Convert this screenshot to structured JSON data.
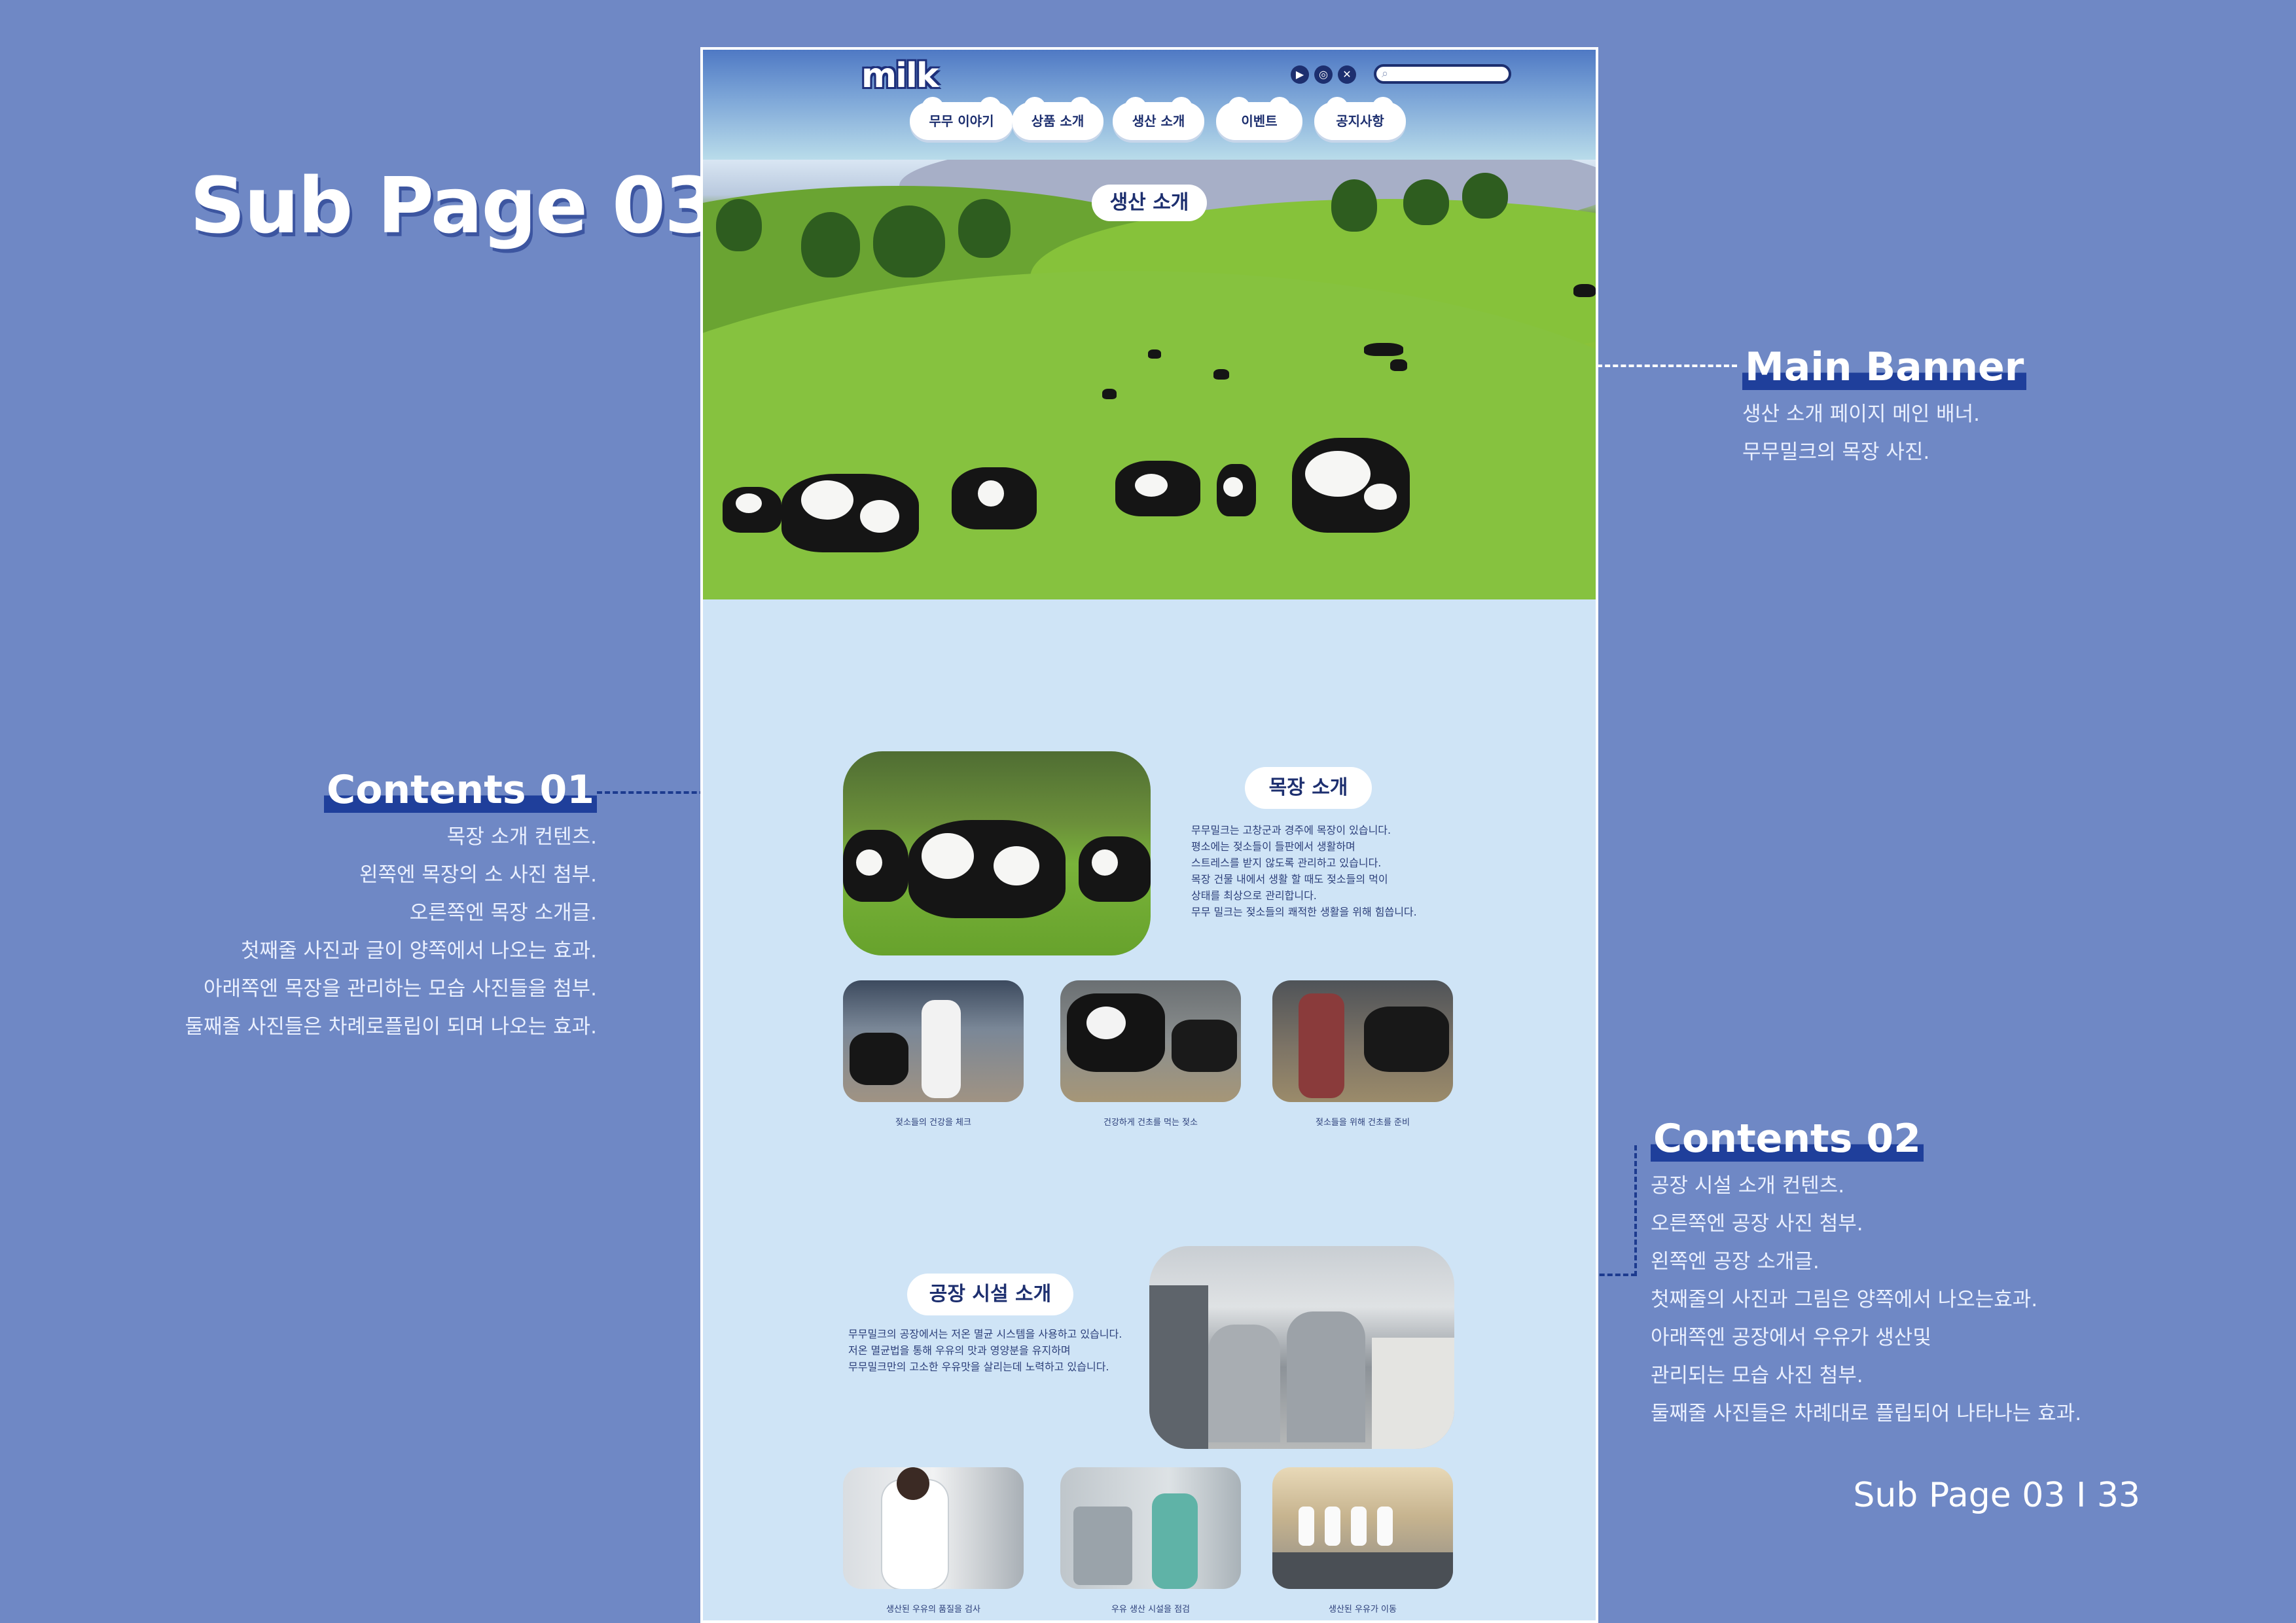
{
  "page": {
    "title": "Sub Page 03",
    "footer": "Sub Page 03 I 33"
  },
  "annotations": {
    "main_banner": {
      "title": "Main Banner",
      "lines": [
        "생산 소개 페이지 메인 배너.",
        "무무밀크의 목장 사진."
      ]
    },
    "contents01": {
      "title": "Contents 01",
      "lines": [
        "목장 소개 컨텐츠.",
        "왼쪽엔 목장의 소 사진 첨부.",
        "오른쪽엔 목장 소개글.",
        "첫째줄 사진과 글이 양쪽에서 나오는 효과.",
        "아래쪽엔 목장을 관리하는 모습 사진들을 첨부.",
        "둘째줄 사진들은 차례로플립이 되며 나오는 효과."
      ]
    },
    "contents02": {
      "title": "Contents 02",
      "lines": [
        "공장 시설 소개 컨텐츠.",
        "오른쪽엔 공장 사진 첨부.",
        "왼쪽엔 공장 소개글.",
        "첫째줄의 사진과 그림은 양쪽에서 나오는효과.",
        "아래쪽엔 공장에서 우유가 생산및",
        "관리되는 모습 사진 첨부.",
        "둘째줄 사진들은 차례대로 플립되어 나타나는 효과."
      ]
    }
  },
  "site": {
    "logo": "milk",
    "search": {
      "placeholder": ""
    },
    "social_icons": [
      "youtube-icon",
      "instagram-icon",
      "x-icon"
    ],
    "nav": [
      "무무 이야기",
      "상품 소개",
      "생산 소개",
      "이벤트",
      "공지사항"
    ],
    "banner_label": "생산 소개",
    "farm": {
      "heading": "목장 소개",
      "lines": [
        "무무밀크는 고창군과 경주에 목장이 있습니다.",
        "평소에는 젖소들이 들판에서 생활하며",
        "스트레스를 받지 않도록 관리하고 있습니다.",
        "목장 건물 내에서 생활 할 때도 젖소들의 먹이",
        "상태를 최상으로 관리합니다.",
        "무무 밀크는 젖소들의 쾌적한 생활을 위해 힘씁니다."
      ],
      "captions": [
        "젖소들의 건강을 체크",
        "건강하게 건초를 먹는 젖소",
        "젖소들을 위해 건초를 준비"
      ]
    },
    "factory": {
      "heading": "공장 시설 소개",
      "lines": [
        "무무밀크의 공장에서는 저온 멸균 시스템을 사용하고 있습니다.",
        "저온 멸균법을 통해 우유의 맛과 영양분을 유지하며",
        "무무밀크만의 고소한 우유맛을 살리는데 노력하고 있습니다."
      ],
      "captions": [
        "생산된 우유의 품질을 검사",
        "우유 생산 시설을 점검",
        "생산된 우유가 이동"
      ]
    }
  },
  "colors": {
    "background": "#6f88c5",
    "site_bg": "#cfe4f6",
    "navy": "#1d2f6f",
    "highlight": "#1f3f9b"
  }
}
